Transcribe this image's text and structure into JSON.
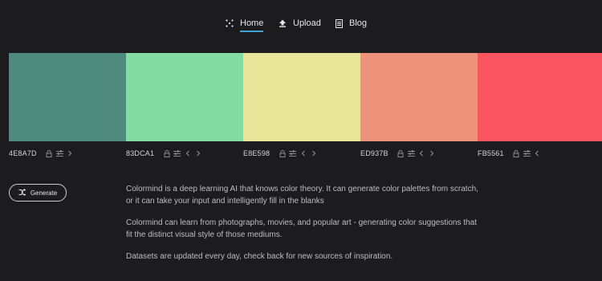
{
  "nav": {
    "home": "Home",
    "upload": "Upload",
    "blog": "Blog",
    "accent": "#3fa3d6"
  },
  "palette": [
    {
      "hex": "4E8A7D",
      "color": "#4E8A7D"
    },
    {
      "hex": "83DCA1",
      "color": "#83DCA1"
    },
    {
      "hex": "E8E598",
      "color": "#E8E598"
    },
    {
      "hex": "ED937B",
      "color": "#ED937B"
    },
    {
      "hex": "FB5561",
      "color": "#FB5561"
    }
  ],
  "icons": {
    "lock": "lock-icon",
    "adjust": "sliders-icon",
    "left": "chevron-left-icon",
    "right": "chevron-right-icon"
  },
  "generate_label": "Generate",
  "description": [
    "Colormind is a deep learning AI that knows color theory. It can generate color palettes from scratch, or it can take your input and intelligently fill in the blanks",
    "Colormind can learn from photographs, movies, and popular art - generating color suggestions that fit the distinct visual style of those mediums.",
    "Datasets are updated every day, check back for new sources of inspiration."
  ]
}
